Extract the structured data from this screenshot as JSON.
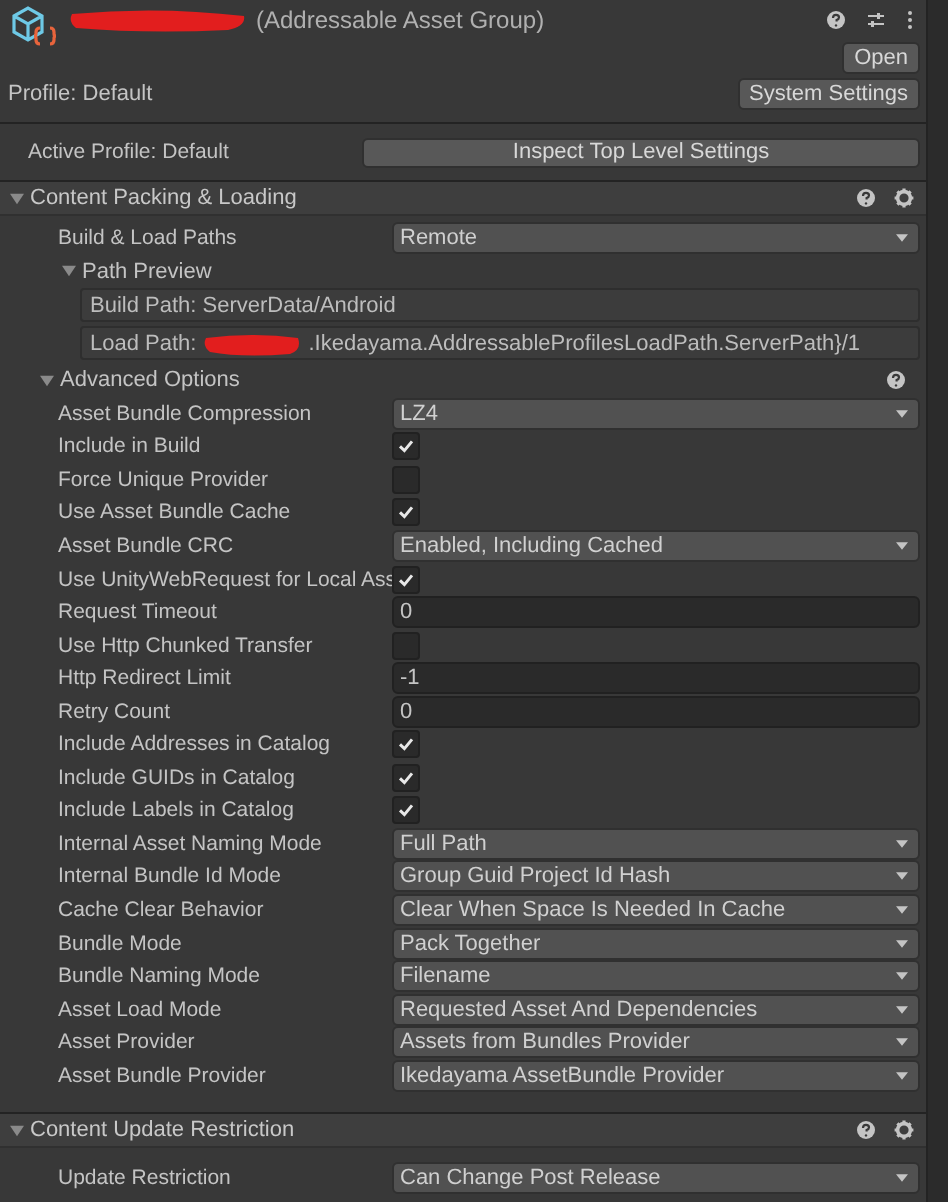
{
  "header": {
    "title": "(Addressable Asset Group)",
    "open_button": "Open",
    "profile": "Profile: Default",
    "system_settings_button": "System Settings"
  },
  "active_profile": {
    "label": "Active Profile: Default",
    "button": "Inspect Top Level Settings"
  },
  "content_packing": {
    "title": "Content Packing & Loading",
    "expanded": true,
    "build_load_paths": {
      "label": "Build & Load Paths",
      "value": "Remote"
    },
    "path_preview": {
      "title": "Path Preview",
      "expanded": true,
      "build_path": "Build Path: ServerData/Android",
      "load_path_label": "Load Path:",
      "load_path_value": ".Ikedayama.AddressableProfilesLoadPath.ServerPath}/1"
    },
    "advanced": {
      "title": "Advanced Options",
      "expanded": true,
      "rows": [
        {
          "kind": "dropdown",
          "label": "Asset Bundle Compression",
          "value": "LZ4"
        },
        {
          "kind": "checkbox",
          "label": "Include in Build",
          "checked": true
        },
        {
          "kind": "checkbox",
          "label": "Force Unique Provider",
          "checked": false
        },
        {
          "kind": "checkbox",
          "label": "Use Asset Bundle Cache",
          "checked": true
        },
        {
          "kind": "dropdown",
          "label": "Asset Bundle CRC",
          "value": "Enabled, Including Cached"
        },
        {
          "kind": "checkbox",
          "label": "Use UnityWebRequest for Local Ass",
          "checked": true
        },
        {
          "kind": "number",
          "label": "Request Timeout",
          "value": "0"
        },
        {
          "kind": "checkbox",
          "label": "Use Http Chunked Transfer",
          "checked": false
        },
        {
          "kind": "number",
          "label": "Http Redirect Limit",
          "value": "-1"
        },
        {
          "kind": "number",
          "label": "Retry Count",
          "value": "0"
        },
        {
          "kind": "checkbox",
          "label": "Include Addresses in Catalog",
          "checked": true
        },
        {
          "kind": "checkbox",
          "label": "Include GUIDs in Catalog",
          "checked": true
        },
        {
          "kind": "checkbox",
          "label": "Include Labels in Catalog",
          "checked": true
        },
        {
          "kind": "dropdown",
          "label": "Internal Asset Naming Mode",
          "value": "Full Path"
        },
        {
          "kind": "dropdown",
          "label": "Internal Bundle Id Mode",
          "value": "Group Guid Project Id Hash"
        },
        {
          "kind": "dropdown",
          "label": "Cache Clear Behavior",
          "value": "Clear When Space Is Needed In Cache"
        },
        {
          "kind": "dropdown",
          "label": "Bundle Mode",
          "value": "Pack Together"
        },
        {
          "kind": "dropdown",
          "label": "Bundle Naming Mode",
          "value": "Filename"
        },
        {
          "kind": "dropdown",
          "label": "Asset Load Mode",
          "value": "Requested Asset And Dependencies"
        },
        {
          "kind": "dropdown",
          "label": "Asset Provider",
          "value": "Assets from Bundles Provider"
        },
        {
          "kind": "dropdown",
          "label": "Asset Bundle Provider",
          "value": "Ikedayama AssetBundle Provider"
        }
      ]
    }
  },
  "content_update": {
    "title": "Content Update Restriction",
    "expanded": true,
    "rows": [
      {
        "kind": "dropdown",
        "label": "Update Restriction",
        "value": "Can Change Post Release"
      }
    ]
  }
}
